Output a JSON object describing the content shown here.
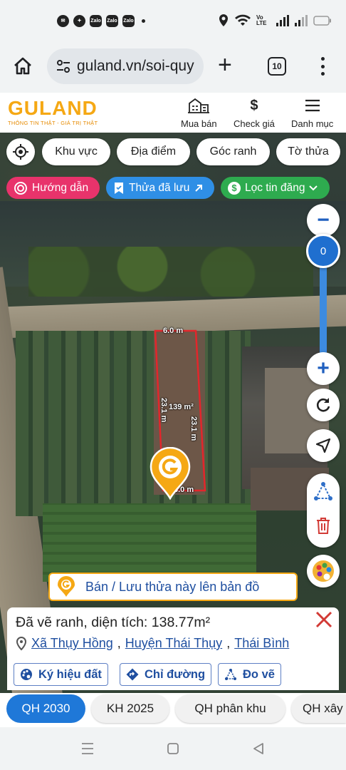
{
  "status_bar": {
    "apps": [
      "Zalo",
      "Zalo",
      "Zalo"
    ],
    "network": "Vo LTE"
  },
  "browser": {
    "url": "guland.vn/soi-quy",
    "tab_count": "10"
  },
  "site": {
    "logo": "GULAND",
    "tagline": "THÔNG TIN THẬT - GIÁ TRỊ THẬT",
    "nav": [
      {
        "label": "Mua bán",
        "icon": "building-icon"
      },
      {
        "label": "Check giá",
        "icon": "dollar-icon"
      },
      {
        "label": "Danh mục",
        "icon": "menu-icon"
      }
    ]
  },
  "filters": {
    "chips": [
      "Khu vực",
      "Địa điểm",
      "Góc ranh",
      "Tờ thửa"
    ],
    "guide": "Hướng dẫn",
    "saved": "Thửa đã lưu",
    "filter_posts": "Lọc tin đăng"
  },
  "map": {
    "zoom_value": "0",
    "parcel": {
      "top_edge": "6.0 m",
      "right_edge": "23.1 m",
      "left_edge": "23.1 m",
      "area_label": "139 m²",
      "bottom_edge": "6.0 m"
    }
  },
  "actions": {
    "save_to_map": "Bán / Lưu thửa này lên bản đồ"
  },
  "info": {
    "title": "Đã vẽ ranh, diện tích: 138.77m²",
    "commune": "Xã Thụy Hồng",
    "district": "Huyện Thái Thụy",
    "province": "Thái Bình",
    "buttons": [
      "Ký hiệu đất",
      "Chỉ đường",
      "Đo vẽ"
    ]
  },
  "layers": [
    {
      "label": "QH 2030",
      "active": true
    },
    {
      "label": "KH 2025",
      "active": false
    },
    {
      "label": "QH phân khu",
      "active": false
    },
    {
      "label": "QH xây",
      "active": false
    }
  ],
  "colors": {
    "brand": "#f5a814",
    "guide_pill": "#e8336b",
    "saved_pill": "#2f8fe6",
    "filter_pill": "#2eab4f",
    "parcel_outline": "#e3262b",
    "active_layer": "#1f78d8",
    "link": "#1f4fa0"
  }
}
